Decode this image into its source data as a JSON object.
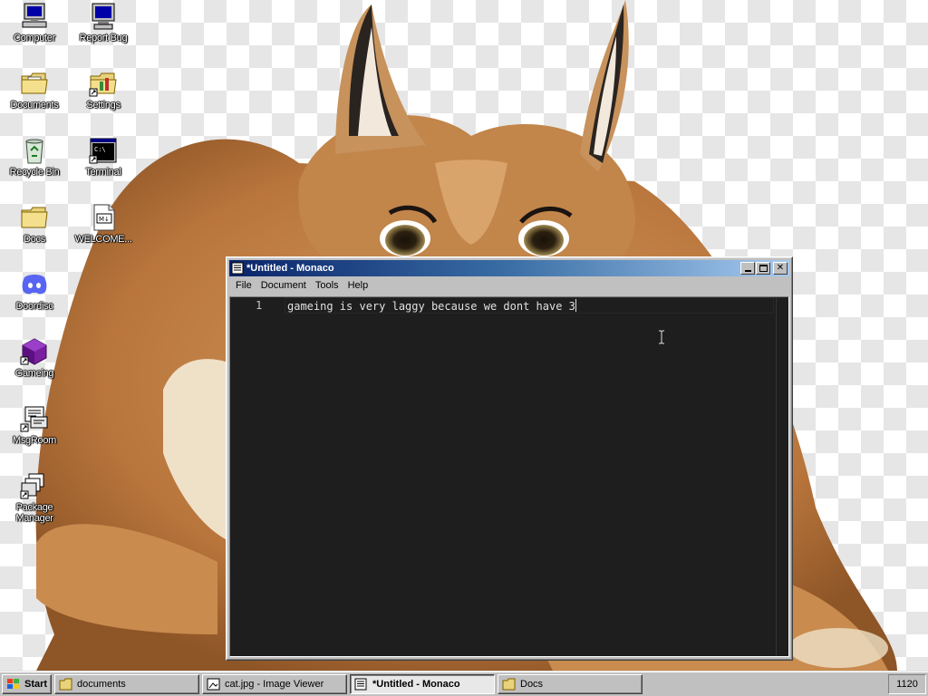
{
  "desktop": {
    "icons": [
      {
        "label": "Computer",
        "icon": "computer-icon"
      },
      {
        "label": "Report Bug",
        "icon": "monitor-bug-icon"
      },
      {
        "label": "Documents",
        "icon": "folder-documents-icon"
      },
      {
        "label": "Settings",
        "icon": "settings-folder-icon"
      },
      {
        "label": "Recycle Bin",
        "icon": "recycle-bin-icon"
      },
      {
        "label": "Terminal",
        "icon": "terminal-icon"
      },
      {
        "label": "Docs",
        "icon": "folder-icon"
      },
      {
        "label": "WELCOME...",
        "icon": "markdown-file-icon"
      },
      {
        "label": "Doordisc",
        "icon": "discord-icon"
      },
      {
        "label": "Gameing",
        "icon": "cube-icon"
      },
      {
        "label": "MsgRoom",
        "icon": "msgroom-icon"
      },
      {
        "label": "Package Manager",
        "icon": "package-icon"
      }
    ],
    "wallpaper": "caracal-cat"
  },
  "window": {
    "title": "*Untitled - Monaco",
    "menu": [
      "File",
      "Document",
      "Tools",
      "Help"
    ],
    "editor": {
      "line_number": "1",
      "text": "gameing is very laggy because we dont have 3"
    },
    "accent": "#0a246a"
  },
  "taskbar": {
    "start_label": "Start",
    "items": [
      {
        "label": "documents",
        "icon": "folder-icon"
      },
      {
        "label": "cat.jpg - Image Viewer",
        "icon": "image-viewer-icon"
      },
      {
        "label": "*Untitled - Monaco",
        "icon": "notepad-icon",
        "active": true
      },
      {
        "label": "Docs",
        "icon": "folder-icon"
      }
    ],
    "clock": "1120"
  }
}
